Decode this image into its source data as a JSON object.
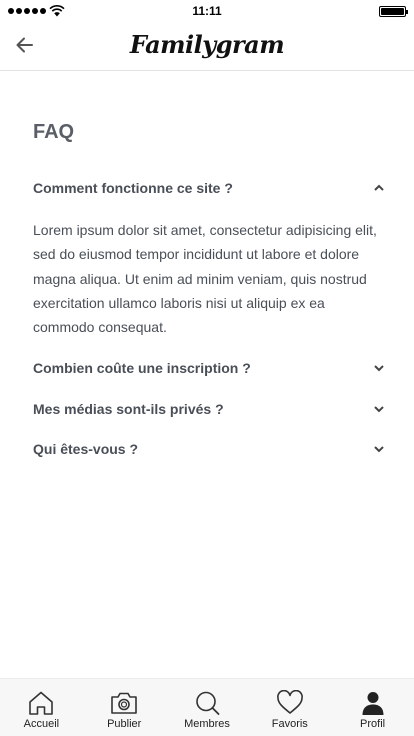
{
  "status_bar": {
    "time": "11:11"
  },
  "header": {
    "logo_text": "Familygram"
  },
  "page": {
    "title": "FAQ"
  },
  "faq": [
    {
      "question": "Comment fonctionne ce site ?",
      "expanded": true,
      "answer": "Lorem ipsum dolor sit amet, consectetur adipisicing elit, sed do eiusmod tempor incididunt ut labore et dolore magna aliqua. Ut enim ad minim veniam, quis nostrud exercitation ullamco laboris nisi ut aliquip ex ea commodo consequat."
    },
    {
      "question": "Combien coûte une inscription ?",
      "expanded": false
    },
    {
      "question": "Mes médias sont-ils privés ?",
      "expanded": false
    },
    {
      "question": "Qui êtes-vous ?",
      "expanded": false
    }
  ],
  "tab_bar": [
    {
      "label": "Accueil",
      "icon": "home-icon"
    },
    {
      "label": "Publier",
      "icon": "camera-icon"
    },
    {
      "label": "Membres",
      "icon": "search-icon"
    },
    {
      "label": "Favoris",
      "icon": "heart-icon"
    },
    {
      "label": "Profil",
      "icon": "person-icon",
      "active": true
    }
  ]
}
